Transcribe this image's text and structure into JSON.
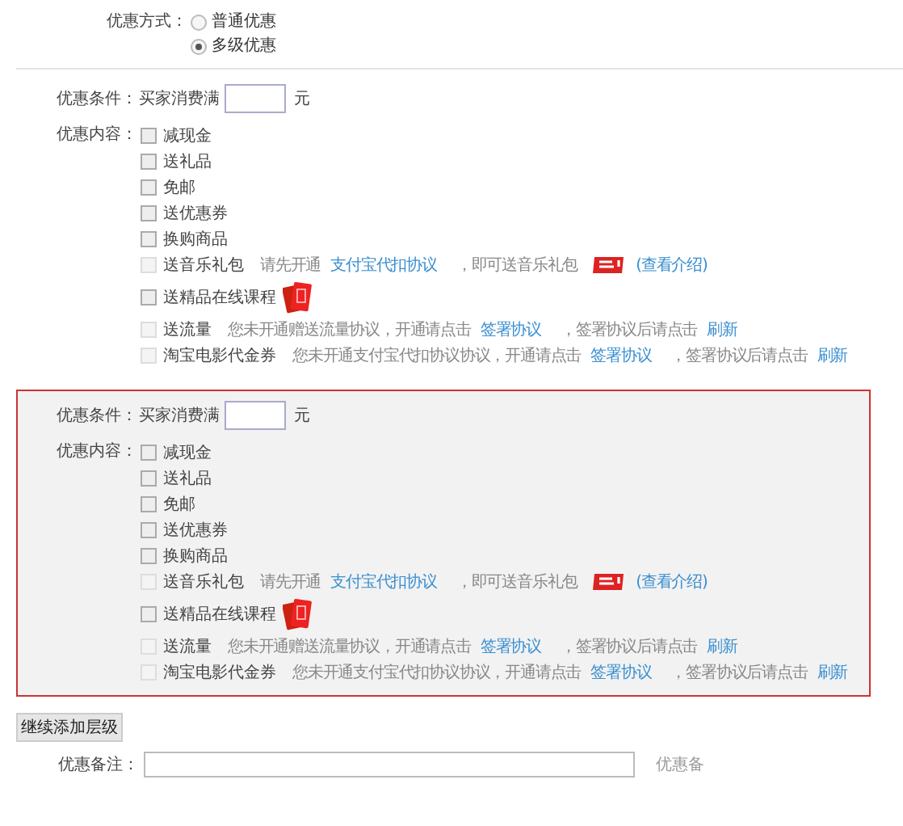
{
  "discount_type": {
    "label": "优惠方式：",
    "options": [
      {
        "label": "普通优惠",
        "selected": false
      },
      {
        "label": "多级优惠",
        "selected": true
      }
    ]
  },
  "levels": [
    {
      "highlighted": false,
      "condition": {
        "label": "优惠条件：",
        "prefix": "买家消费满",
        "unit": "元"
      },
      "content_label": "优惠内容：",
      "items": [
        {
          "label": "减现金",
          "checked": false,
          "disabled": false
        },
        {
          "label": "送礼品",
          "checked": false,
          "disabled": false
        },
        {
          "label": "免邮",
          "checked": false,
          "disabled": false
        },
        {
          "label": "送优惠券",
          "checked": false,
          "disabled": false
        },
        {
          "label": "换购商品",
          "checked": false,
          "disabled": false
        },
        {
          "label": "送音乐礼包",
          "checked": false,
          "disabled": true,
          "note": [
            {
              "kind": "text",
              "text": "请先开通"
            },
            {
              "kind": "link",
              "text": "支付宝代扣协议"
            },
            {
              "kind": "text",
              "text": "，即可送音乐礼包"
            },
            {
              "kind": "new_badge"
            },
            {
              "kind": "link",
              "text": "(查看介绍)"
            }
          ]
        },
        {
          "label": "送精品在线课程",
          "checked": false,
          "disabled": false,
          "note": [
            {
              "kind": "cards"
            }
          ]
        },
        {
          "label": "送流量",
          "checked": false,
          "disabled": true,
          "note": [
            {
              "kind": "text",
              "text": "您未开通赠送流量协议，开通请点击"
            },
            {
              "kind": "link",
              "text": "签署协议"
            },
            {
              "kind": "text",
              "text": "，签署协议后请点击"
            },
            {
              "kind": "link",
              "text": "刷新"
            }
          ]
        },
        {
          "label": "淘宝电影代金券",
          "checked": false,
          "disabled": true,
          "note": [
            {
              "kind": "text",
              "text": "您未开通支付宝代扣协议协议，开通请点击"
            },
            {
              "kind": "link",
              "text": "签署协议"
            },
            {
              "kind": "text",
              "text": "，签署协议后请点击"
            },
            {
              "kind": "link",
              "text": "刷新"
            }
          ]
        }
      ]
    },
    {
      "highlighted": true,
      "condition": {
        "label": "优惠条件：",
        "prefix": "买家消费满",
        "unit": "元"
      },
      "content_label": "优惠内容：",
      "items": [
        {
          "label": "减现金",
          "checked": false,
          "disabled": false
        },
        {
          "label": "送礼品",
          "checked": false,
          "disabled": false
        },
        {
          "label": "免邮",
          "checked": false,
          "disabled": false
        },
        {
          "label": "送优惠券",
          "checked": false,
          "disabled": false
        },
        {
          "label": "换购商品",
          "checked": false,
          "disabled": false
        },
        {
          "label": "送音乐礼包",
          "checked": false,
          "disabled": true,
          "note": [
            {
              "kind": "text",
              "text": "请先开通"
            },
            {
              "kind": "link",
              "text": "支付宝代扣协议"
            },
            {
              "kind": "text",
              "text": "，即可送音乐礼包"
            },
            {
              "kind": "new_badge"
            },
            {
              "kind": "link",
              "text": "(查看介绍)"
            }
          ]
        },
        {
          "label": "送精品在线课程",
          "checked": false,
          "disabled": false,
          "note": [
            {
              "kind": "cards"
            }
          ]
        },
        {
          "label": "送流量",
          "checked": false,
          "disabled": true,
          "note": [
            {
              "kind": "text",
              "text": "您未开通赠送流量协议，开通请点击"
            },
            {
              "kind": "link",
              "text": "签署协议"
            },
            {
              "kind": "text",
              "text": "，签署协议后请点击"
            },
            {
              "kind": "link",
              "text": "刷新"
            }
          ]
        },
        {
          "label": "淘宝电影代金券",
          "checked": false,
          "disabled": true,
          "note": [
            {
              "kind": "text",
              "text": "您未开通支付宝代扣协议协议，开通请点击"
            },
            {
              "kind": "link",
              "text": "签署协议"
            },
            {
              "kind": "text",
              "text": "，签署协议后请点击"
            },
            {
              "kind": "link",
              "text": "刷新"
            }
          ]
        }
      ]
    }
  ],
  "add_level_button": "继续添加层级",
  "remark": {
    "label": "优惠备注：",
    "hint": "优惠备"
  }
}
